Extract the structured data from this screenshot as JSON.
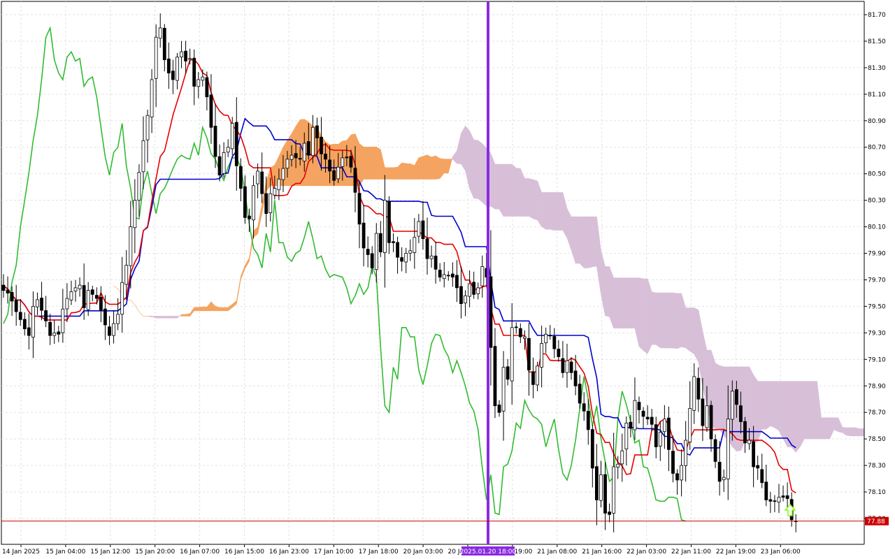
{
  "chart_data": {
    "type": "candlestick",
    "title": "",
    "xlabel": "",
    "ylabel": "",
    "grid": true,
    "ylim": [
      77.66,
      81.8
    ],
    "y_ticks": [
      "81.70",
      "81.50",
      "81.30",
      "81.10",
      "80.90",
      "80.70",
      "80.50",
      "80.30",
      "80.10",
      "79.90",
      "79.70",
      "79.50",
      "79.30",
      "79.10",
      "78.90",
      "78.70",
      "78.50",
      "78.30",
      "78.10",
      "77.90"
    ],
    "x_ticks": [
      "14 Jan 2025",
      "15 Jan 04:00",
      "15 Jan 12:00",
      "15 Jan 20:00",
      "16 Jan 07:00",
      "16 Jan 15:00",
      "16 Jan 23:00",
      "17 Jan 10:00",
      "17 Jan 18:00",
      "20 Jan 03:00",
      "20 Jan 11:00",
      "20 Jan 19:00",
      "21 Jan 08:00",
      "21 Jan 16:00",
      "22 Jan 03:00",
      "22 Jan 11:00",
      "22 Jan 19:00",
      "23 Jan 06:00"
    ],
    "crosshair_time_label": "2025.01.20 18:00",
    "current_price_label": "77.88",
    "current_price": 77.88,
    "candle_count": 186,
    "bull_color": "#ffffff",
    "bear_color": "#000000",
    "past_bull_color": "#ffffff",
    "past_bear_color": "#1f4e99",
    "colors": {
      "tenkan": "#e60000",
      "kijun": "#0000cc",
      "chikou": "#33bb33",
      "kumo_bull": "#f4a460",
      "kumo_bear": "#d8bfd8",
      "vline": "#8a2be2",
      "price_line": "#cc0000",
      "arrow": "#7cfc00",
      "past_tenkan": "#ff66aa",
      "past_kijun": "#2f6f4f"
    },
    "closes": [
      79.62,
      79.6,
      79.54,
      79.46,
      79.4,
      79.33,
      79.28,
      79.5,
      79.55,
      79.47,
      79.39,
      79.28,
      79.3,
      79.29,
      79.48,
      79.56,
      79.61,
      79.64,
      79.66,
      79.49,
      79.62,
      79.59,
      79.56,
      79.47,
      79.36,
      79.28,
      79.37,
      79.44,
      79.68,
      79.81,
      80.1,
      80.3,
      80.51,
      80.75,
      80.94,
      81.21,
      81.53,
      81.6,
      81.36,
      81.26,
      81.21,
      81.38,
      81.42,
      81.35,
      81.37,
      81.16,
      81.21,
      81.23,
      81.08,
      80.85,
      80.63,
      80.49,
      80.66,
      80.7,
      80.88,
      80.56,
      80.39,
      80.17,
      80.16,
      80.41,
      80.52,
      80.35,
      80.2,
      80.35,
      80.39,
      80.46,
      80.54,
      80.61,
      80.64,
      80.62,
      80.61,
      80.73,
      80.64,
      80.85,
      80.77,
      80.65,
      80.61,
      80.52,
      80.45,
      80.55,
      80.62,
      80.62,
      80.55,
      80.36,
      80.12,
      79.94,
      79.89,
      79.79,
      80.05,
      79.91,
      80.3,
      79.98,
      79.98,
      79.87,
      79.84,
      79.9,
      79.92,
      80.02,
      80.14,
      80.01,
      79.86,
      79.88,
      79.78,
      79.72,
      79.74,
      79.73,
      79.72,
      79.64,
      79.52,
      79.58,
      79.67,
      79.59,
      79.64,
      79.8,
      79.72,
      79.19,
      78.75,
      78.7,
      79.04,
      78.95,
      79.34,
      79.34,
      79.27,
      79.27,
      79.02,
      78.91,
      79.05,
      79.22,
      79.29,
      79.28,
      79.18,
      79.12,
      79.0,
      79.09,
      79.0,
      78.9,
      78.77,
      78.71,
      78.57,
      78.28,
      78.04,
      78.23,
      77.94,
      77.93,
      78.29,
      78.31,
      78.41,
      78.62,
      78.58,
      78.79,
      78.72,
      78.67,
      78.65,
      78.61,
      78.44,
      78.55,
      78.65,
      78.42,
      78.24,
      78.19,
      78.3,
      78.49,
      78.73,
      78.97,
      78.8,
      78.6,
      78.75,
      78.5,
      78.33,
      78.18,
      78.21,
      78.65,
      78.86,
      78.76,
      78.63,
      78.47,
      78.49,
      78.29,
      78.28,
      78.17,
      78.04,
      78.03,
      78.03,
      78.06,
      78.06,
      78.05,
      77.89,
      77.88
    ],
    "kumo_rows_to_candle_scale": "1 candle = 6.1 px approx"
  }
}
